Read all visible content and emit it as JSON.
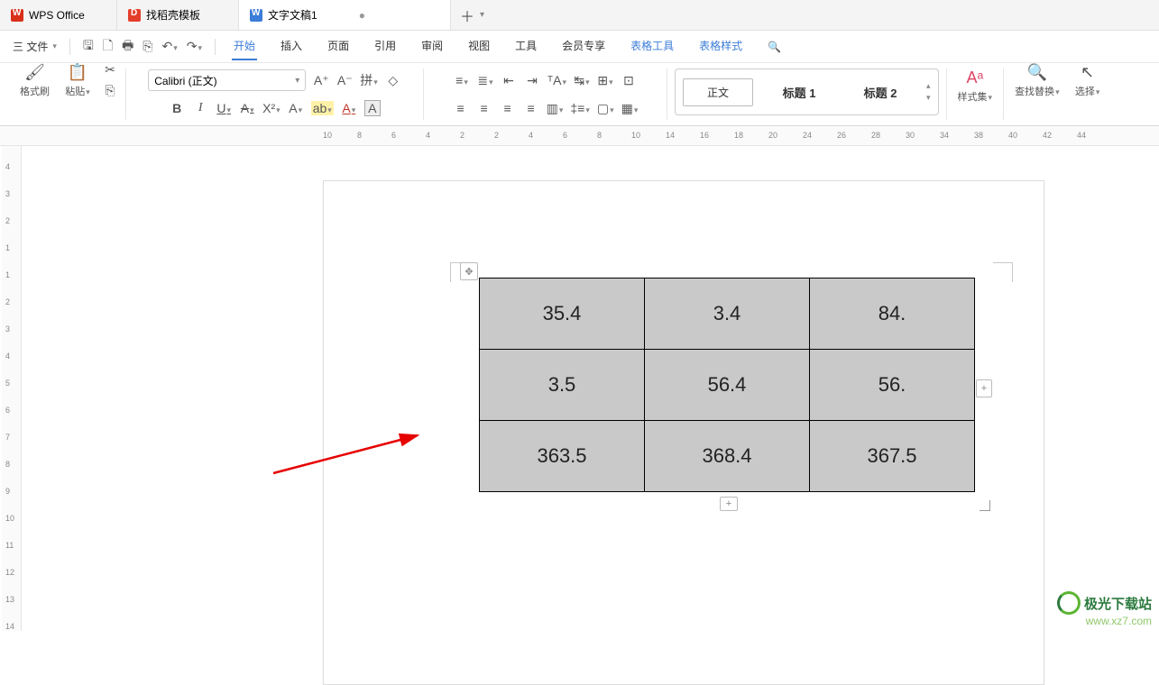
{
  "tabs": {
    "app": "WPS Office",
    "template": "找稻壳模板",
    "doc": "文字文稿1"
  },
  "menubar": {
    "file": "三 文件",
    "items": [
      "开始",
      "插入",
      "页面",
      "引用",
      "审阅",
      "视图",
      "工具",
      "会员专享",
      "表格工具",
      "表格样式"
    ]
  },
  "ribbon": {
    "format_painter": "格式刷",
    "paste": "粘贴",
    "font": "Calibri (正文)",
    "styles": {
      "normal": "正文",
      "h1": "标题 1",
      "h2": "标题 2"
    },
    "styleset": "样式集",
    "findreplace": "查找替换",
    "select": "选择"
  },
  "ruler": {
    "ticks": [
      10,
      8,
      6,
      4,
      2,
      2,
      4,
      6,
      8,
      10,
      14,
      16,
      18,
      20,
      24,
      26,
      28,
      30,
      34,
      38,
      40,
      42,
      44
    ]
  },
  "vruler": {
    "ticks": [
      4,
      3,
      2,
      1,
      1,
      2,
      3,
      4,
      5,
      6,
      7,
      8,
      9,
      10,
      11,
      12,
      13,
      14
    ]
  },
  "table": {
    "rows": [
      [
        "35.4",
        "3.4",
        "84."
      ],
      [
        "3.5",
        "56.4",
        "56."
      ],
      [
        "363.5",
        "368.4",
        "367.5"
      ]
    ]
  },
  "watermark": {
    "name": "极光下载站",
    "url": "www.xz7.com"
  }
}
